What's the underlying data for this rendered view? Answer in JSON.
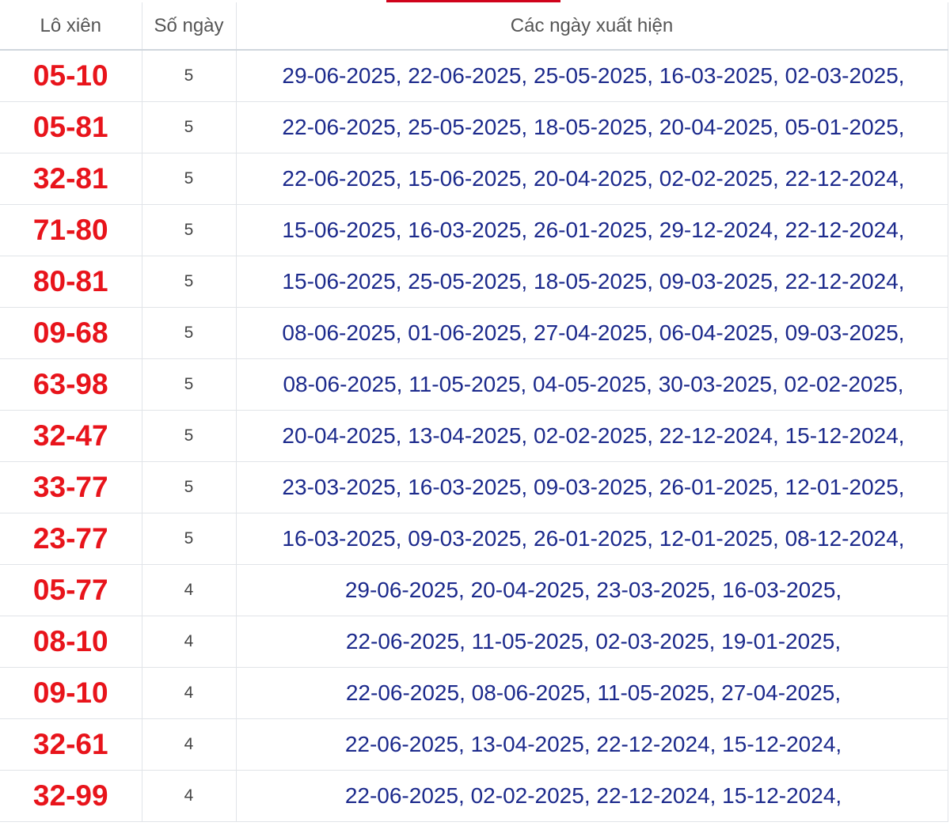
{
  "table": {
    "headers": [
      "Lô xiên",
      "Số ngày",
      "Các ngày xuất hiện"
    ],
    "accent_color": "#d0021b",
    "pair_color": "#e8141b",
    "date_color": "#1c2a8c",
    "rows": [
      {
        "pair": "05-10",
        "count": "5",
        "dates": "29-06-2025, 22-06-2025, 25-05-2025, 16-03-2025, 02-03-2025,"
      },
      {
        "pair": "05-81",
        "count": "5",
        "dates": "22-06-2025, 25-05-2025, 18-05-2025, 20-04-2025, 05-01-2025,"
      },
      {
        "pair": "32-81",
        "count": "5",
        "dates": "22-06-2025, 15-06-2025, 20-04-2025, 02-02-2025, 22-12-2024,"
      },
      {
        "pair": "71-80",
        "count": "5",
        "dates": "15-06-2025, 16-03-2025, 26-01-2025, 29-12-2024, 22-12-2024,"
      },
      {
        "pair": "80-81",
        "count": "5",
        "dates": "15-06-2025, 25-05-2025, 18-05-2025, 09-03-2025, 22-12-2024,"
      },
      {
        "pair": "09-68",
        "count": "5",
        "dates": "08-06-2025, 01-06-2025, 27-04-2025, 06-04-2025, 09-03-2025,"
      },
      {
        "pair": "63-98",
        "count": "5",
        "dates": "08-06-2025, 11-05-2025, 04-05-2025, 30-03-2025, 02-02-2025,"
      },
      {
        "pair": "32-47",
        "count": "5",
        "dates": "20-04-2025, 13-04-2025, 02-02-2025, 22-12-2024, 15-12-2024,"
      },
      {
        "pair": "33-77",
        "count": "5",
        "dates": "23-03-2025, 16-03-2025, 09-03-2025, 26-01-2025, 12-01-2025,"
      },
      {
        "pair": "23-77",
        "count": "5",
        "dates": "16-03-2025, 09-03-2025, 26-01-2025, 12-01-2025, 08-12-2024,"
      },
      {
        "pair": "05-77",
        "count": "4",
        "dates": "29-06-2025, 20-04-2025, 23-03-2025, 16-03-2025,"
      },
      {
        "pair": "08-10",
        "count": "4",
        "dates": "22-06-2025, 11-05-2025, 02-03-2025, 19-01-2025,"
      },
      {
        "pair": "09-10",
        "count": "4",
        "dates": "22-06-2025, 08-06-2025, 11-05-2025, 27-04-2025,"
      },
      {
        "pair": "32-61",
        "count": "4",
        "dates": "22-06-2025, 13-04-2025, 22-12-2024, 15-12-2024,"
      },
      {
        "pair": "32-99",
        "count": "4",
        "dates": "22-06-2025, 02-02-2025, 22-12-2024, 15-12-2024,"
      }
    ]
  }
}
